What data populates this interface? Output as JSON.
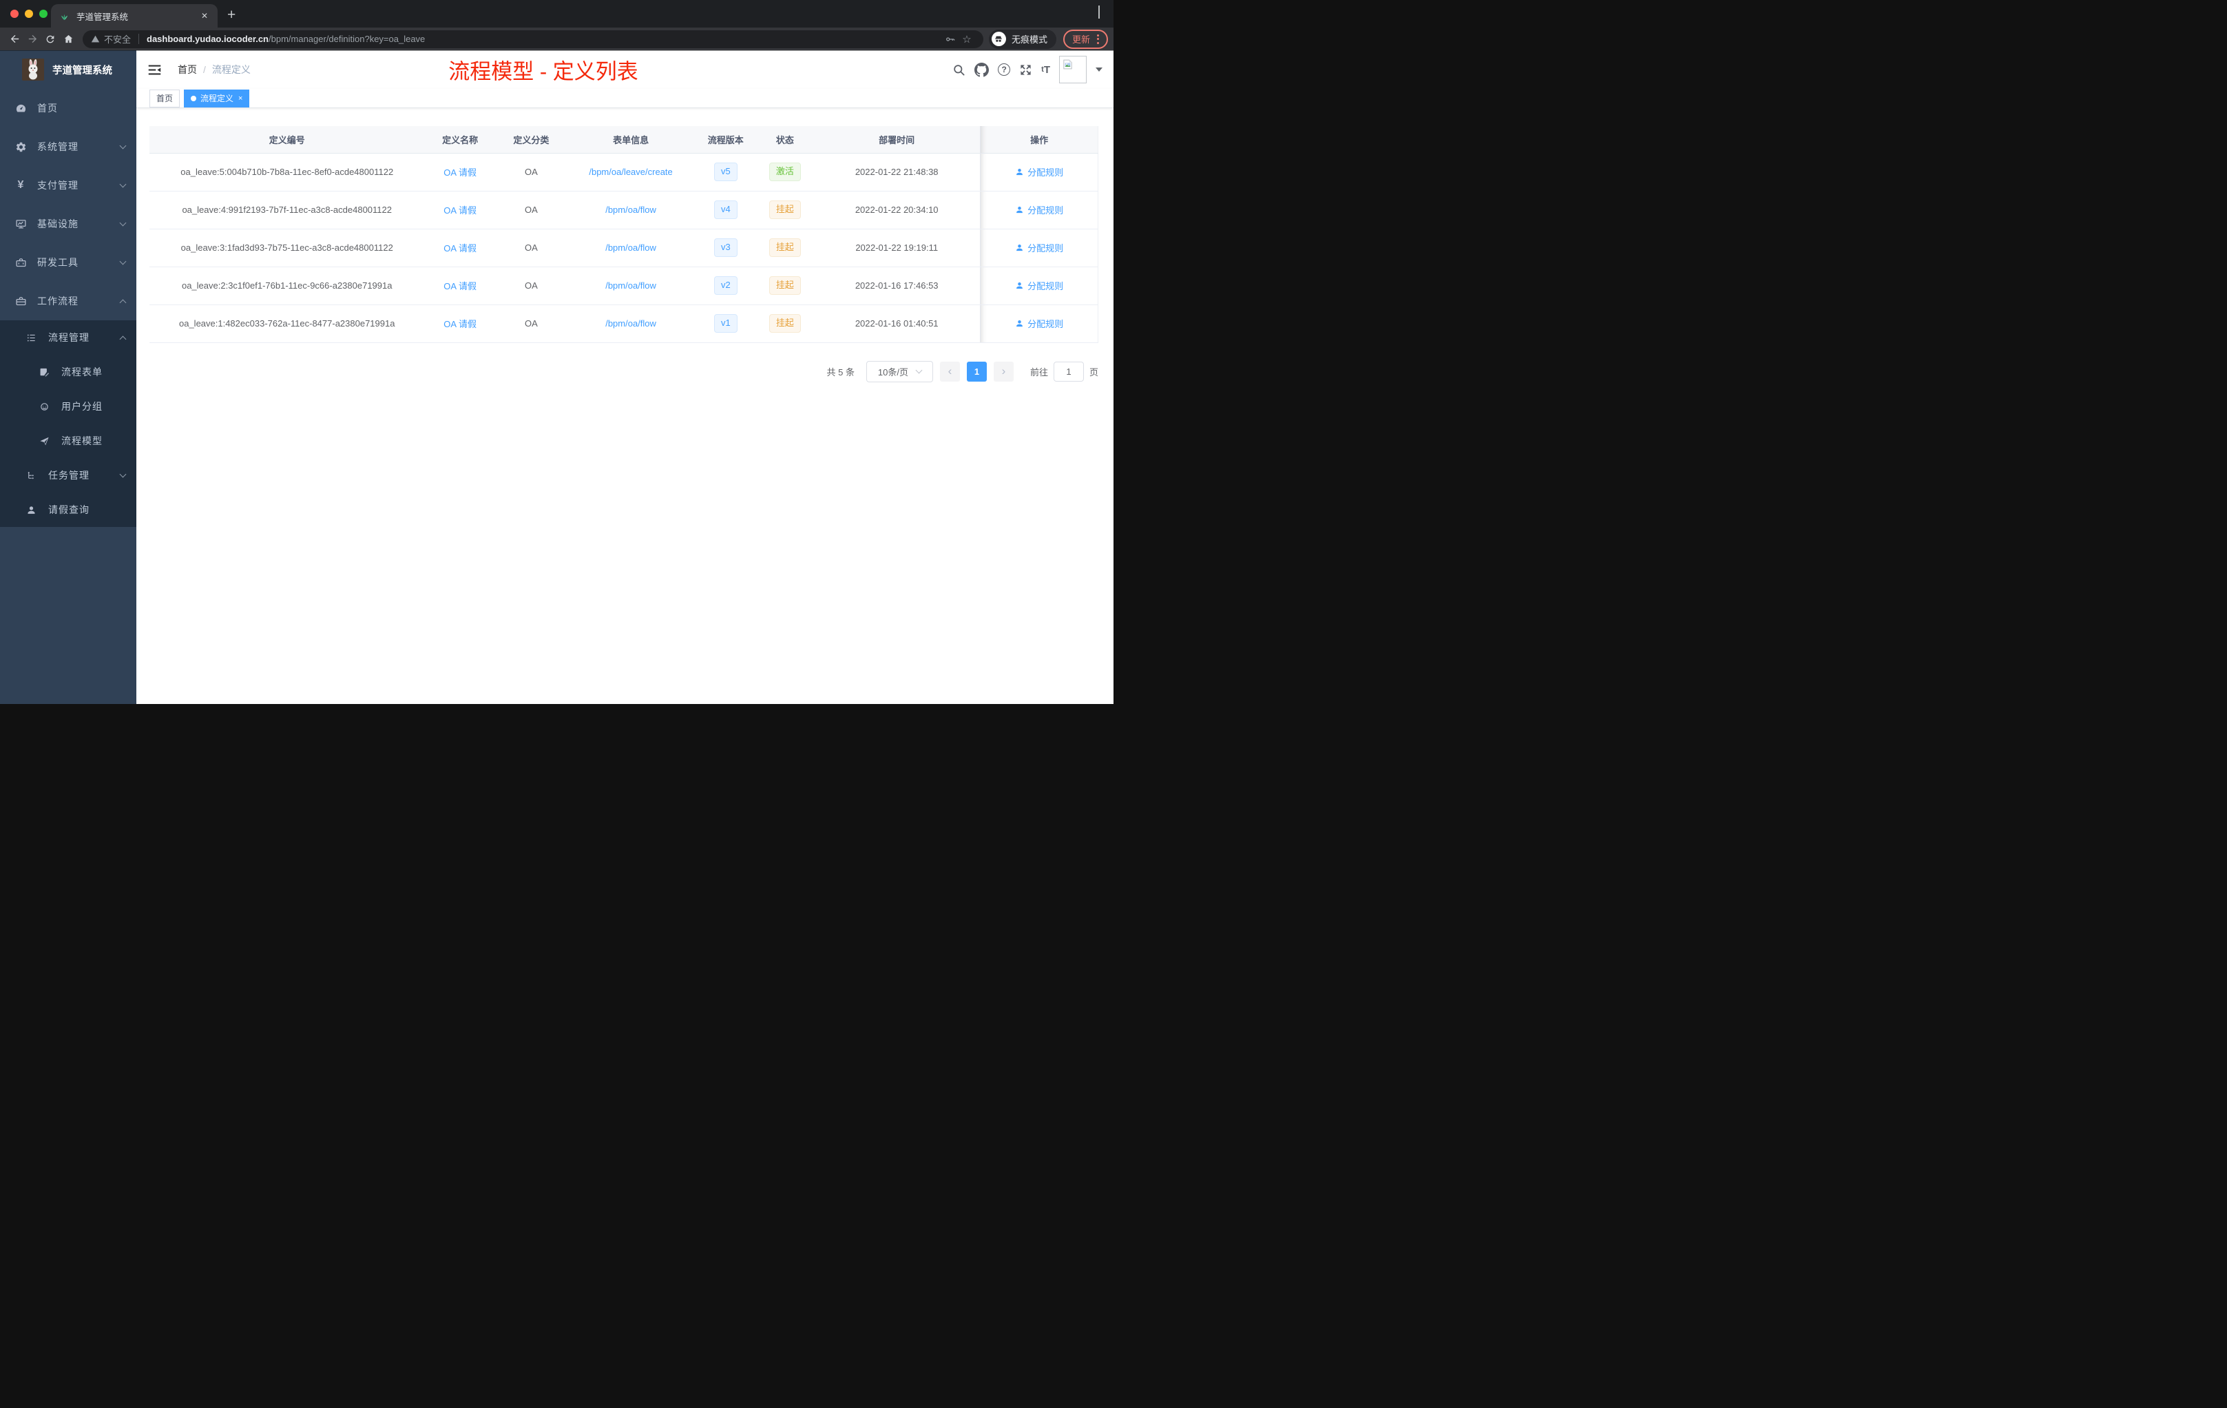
{
  "browser": {
    "tab_title": "芋道管理系统",
    "tab_close": "✕",
    "new_tab": "+",
    "security_label": "不安全",
    "url_domain": "dashboard.yudao.iocoder.cn",
    "url_path": "/bpm/manager/definition?key=oa_leave",
    "incognito_label": "无痕模式",
    "update_label": "更新",
    "star_glyph": "☆"
  },
  "sidebar": {
    "logo_title": "芋道管理系统",
    "menu": [
      {
        "label": "首页"
      },
      {
        "label": "系统管理"
      },
      {
        "label": "支付管理",
        "icon_glyph": "¥"
      },
      {
        "label": "基础设施"
      },
      {
        "label": "研发工具"
      },
      {
        "label": "工作流程"
      }
    ],
    "submenu": [
      {
        "label": "流程管理"
      },
      {
        "label": "流程表单"
      },
      {
        "label": "用户分组"
      },
      {
        "label": "流程模型"
      },
      {
        "label": "任务管理"
      },
      {
        "label": "请假查询"
      }
    ]
  },
  "header": {
    "breadcrumb": {
      "home": "首页",
      "sep": "/",
      "current": "流程定义"
    },
    "annotation": "流程模型 - 定义列表",
    "annotation_color": "#f4290c",
    "help_glyph": "?",
    "font_size_glyph_small": "t",
    "font_size_glyph_big": "T"
  },
  "tags": {
    "first": "首页",
    "active": "流程定义",
    "close": "×"
  },
  "table": {
    "columns": [
      "定义编号",
      "定义名称",
      "定义分类",
      "表单信息",
      "流程版本",
      "状态",
      "部署时间",
      "操作"
    ],
    "action_label": "分配规则",
    "rows": [
      {
        "id": "oa_leave:5:004b710b-7b8a-11ec-8ef0-acde48001122",
        "name": "OA 请假",
        "category": "OA",
        "form": "/bpm/oa/leave/create",
        "version": "v5",
        "status": "激活",
        "time": "2022-01-22 21:48:38"
      },
      {
        "id": "oa_leave:4:991f2193-7b7f-11ec-a3c8-acde48001122",
        "name": "OA 请假",
        "category": "OA",
        "form": "/bpm/oa/flow",
        "version": "v4",
        "status": "挂起",
        "time": "2022-01-22 20:34:10"
      },
      {
        "id": "oa_leave:3:1fad3d93-7b75-11ec-a3c8-acde48001122",
        "name": "OA 请假",
        "category": "OA",
        "form": "/bpm/oa/flow",
        "version": "v3",
        "status": "挂起",
        "time": "2022-01-22 19:19:11"
      },
      {
        "id": "oa_leave:2:3c1f0ef1-76b1-11ec-9c66-a2380e71991a",
        "name": "OA 请假",
        "category": "OA",
        "form": "/bpm/oa/flow",
        "version": "v2",
        "status": "挂起",
        "time": "2022-01-16 17:46:53"
      },
      {
        "id": "oa_leave:1:482ec033-762a-11ec-8477-a2380e71991a",
        "name": "OA 请假",
        "category": "OA",
        "form": "/bpm/oa/flow",
        "version": "v1",
        "status": "挂起",
        "time": "2022-01-16 01:40:51"
      }
    ]
  },
  "pagination": {
    "total": "共 5 条",
    "page_size": "10条/页",
    "prev": "‹",
    "next": "›",
    "current": "1",
    "goto_label": "前往",
    "goto_value": "1",
    "goto_unit": "页"
  },
  "colors": {
    "accent": "#409eff",
    "status_active": "#67c23a",
    "status_suspended": "#e6a23c",
    "sidebar_bg": "#304156",
    "submenu_bg": "#1f2d3d"
  }
}
